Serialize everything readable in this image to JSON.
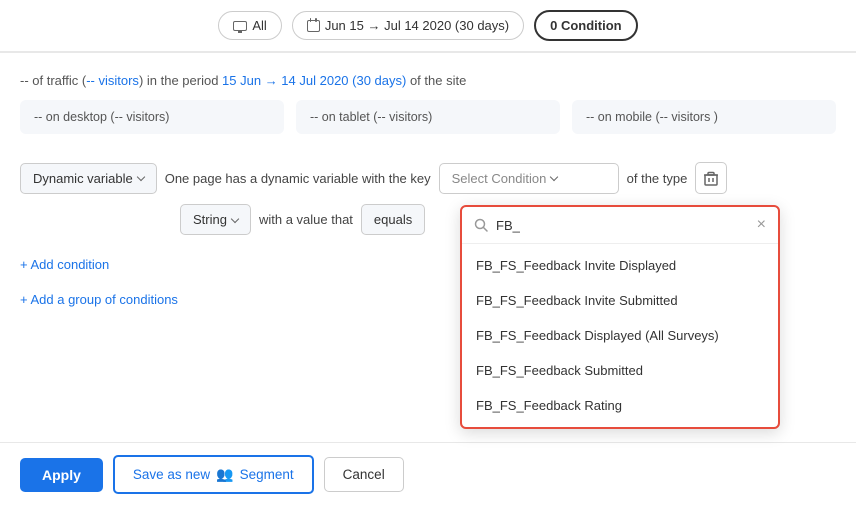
{
  "topBar": {
    "allLabel": "All",
    "dateRange": "Jun 15 → Jul 14 2020 (30 days)",
    "conditionLabel": "0 Condition"
  },
  "summary": {
    "prefix": "-- of traffic (",
    "visitorsLink": "-- visitors",
    "middle": ") in the period ",
    "dateLink": "15 Jun → 14 Jul 2020 (30 days)",
    "suffix": " of the site"
  },
  "devices": {
    "desktop": "-- on desktop (-- visitors)",
    "tablet": "-- on tablet (-- visitors)",
    "mobile": "-- on mobile (-- visitors )"
  },
  "condition": {
    "dynamicVariableLabel": "Dynamic variable",
    "conditionTextMain": "One page has a dynamic variable with the key",
    "selectConditionPlaceholder": "Select Condition",
    "typeLabel": "of the type",
    "stringLabel": "String",
    "valueLabel": "with a value that",
    "equalsLabel": "equals"
  },
  "addLinks": {
    "addCondition": "+ Add condition",
    "addGroup": "+ Add a group of conditions"
  },
  "dropdown": {
    "searchValue": "FB_",
    "searchPlaceholder": "FB_",
    "items": [
      "FB_FS_Feedback Invite Displayed",
      "FB_FS_Feedback Invite Submitted",
      "FB_FS_Feedback Displayed (All Surveys)",
      "FB_FS_Feedback Submitted",
      "FB_FS_Feedback Rating"
    ]
  },
  "actions": {
    "applyLabel": "Apply",
    "saveSegmentLabel": "Save as new",
    "segmentLabel": "Segment",
    "cancelLabel": "Cancel"
  },
  "icons": {
    "search": "🔍",
    "close": "×",
    "trash": "🗑",
    "people": "👥",
    "chevronDown": "▾"
  }
}
